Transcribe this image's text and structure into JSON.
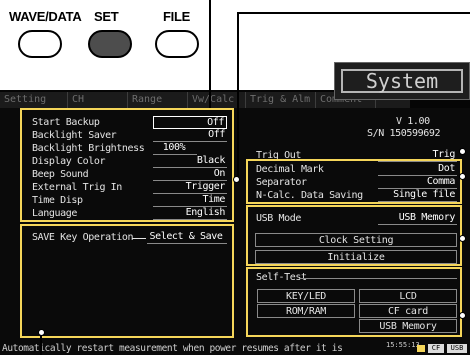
{
  "hardware_keys": [
    {
      "label": "WAVE/DATA",
      "filled": false
    },
    {
      "label": "SET",
      "filled": true
    },
    {
      "label": "FILE",
      "filled": false
    }
  ],
  "screen_title": "System",
  "tabs": [
    "Setting",
    "CH",
    "Range",
    "Vw/Calc",
    "Trig & Alm",
    "Comment",
    "System"
  ],
  "version": "V 1.00",
  "serial": "S/N 150599692",
  "left_panel": {
    "rows": [
      {
        "label": "Start Backup",
        "value": "Off"
      },
      {
        "label": "Backlight Saver",
        "value": "Off"
      },
      {
        "label": "Backlight Brightness",
        "value": "100%"
      },
      {
        "label": "Display Color",
        "value": "Black"
      },
      {
        "label": "Beep Sound",
        "value": "On"
      },
      {
        "label": "External Trig In",
        "value": "Trigger"
      },
      {
        "label": "Time Disp",
        "value": "Time"
      },
      {
        "label": "Language",
        "value": "English"
      }
    ],
    "save_key_label": "SAVE Key Operation",
    "save_key_value": "Select & Save"
  },
  "right_panel": {
    "trig_out_label": "Trig Out",
    "trig_out_value": "Trig",
    "decimal_mark_label": "Decimal Mark",
    "decimal_mark_value": "Dot",
    "separator_label": "Separator",
    "separator_value": "Comma",
    "ncalc_label": "N-Calc. Data Saving",
    "ncalc_value": "Single file",
    "usb_mode_label": "USB Mode",
    "usb_mode_value": "USB Memory",
    "clock_setting": "Clock Setting",
    "initialize": "Initialize",
    "self_test_label": "Self-Test",
    "self_test_buttons": [
      "KEY/LED",
      "LCD",
      "ROM/RAM",
      "CF card",
      "USB Memory"
    ]
  },
  "status_bar": {
    "message": "Automatically restart measurement when power resumes after it is",
    "time": "15:55:13",
    "badges": [
      "CF",
      "USB"
    ]
  },
  "colors": {
    "callout": "#f5d65a",
    "screen_bg": "#0a0a0a",
    "set_key": "#4d4d4d"
  }
}
